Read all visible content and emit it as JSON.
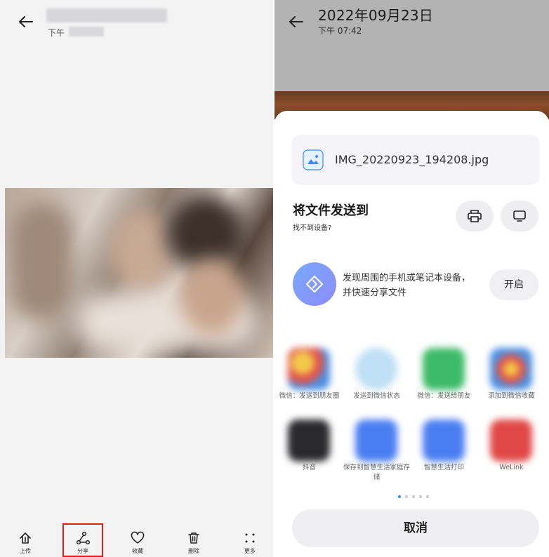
{
  "left": {
    "subtitle_prefix": "下午",
    "nav": [
      {
        "label": "上传",
        "icon": "upload-icon"
      },
      {
        "label": "分享",
        "icon": "share-icon"
      },
      {
        "label": "收藏",
        "icon": "heart-icon"
      },
      {
        "label": "删除",
        "icon": "trash-icon"
      },
      {
        "label": "更多",
        "icon": "more-icon"
      }
    ],
    "highlight_color": "#e0201e"
  },
  "right": {
    "title": "2022年09月23日",
    "time": "下午 07:42",
    "file": {
      "name": "IMG_20220923_194208.jpg",
      "icon": "image-file-icon"
    },
    "send": {
      "title": "将文件发送到",
      "subtitle": "找不到设备?"
    },
    "discover": {
      "line1": "发现周围的手机或笔记本设备，",
      "line2": "并快速分享文件",
      "button": "开启"
    },
    "apps": [
      {
        "label": "微信：发送到朋友圈",
        "color": "#e8a4b8"
      },
      {
        "label": "发送到微信状态",
        "color": "#bfe0f6"
      },
      {
        "label": "微信：发送给朋友",
        "color": "#3dbb68"
      },
      {
        "label": "添加到微信收藏",
        "color": "#f0a050"
      },
      {
        "label": "抖音",
        "color": "#2a2a2e"
      },
      {
        "label": "保存到智慧生活家庭存储",
        "color": "#4a7ef0"
      },
      {
        "label": "智慧生活打印",
        "color": "#4a7ef0"
      },
      {
        "label": "WeLink",
        "color": "#e04848"
      }
    ],
    "cancel": "取消",
    "accent": "#3a86ff"
  }
}
